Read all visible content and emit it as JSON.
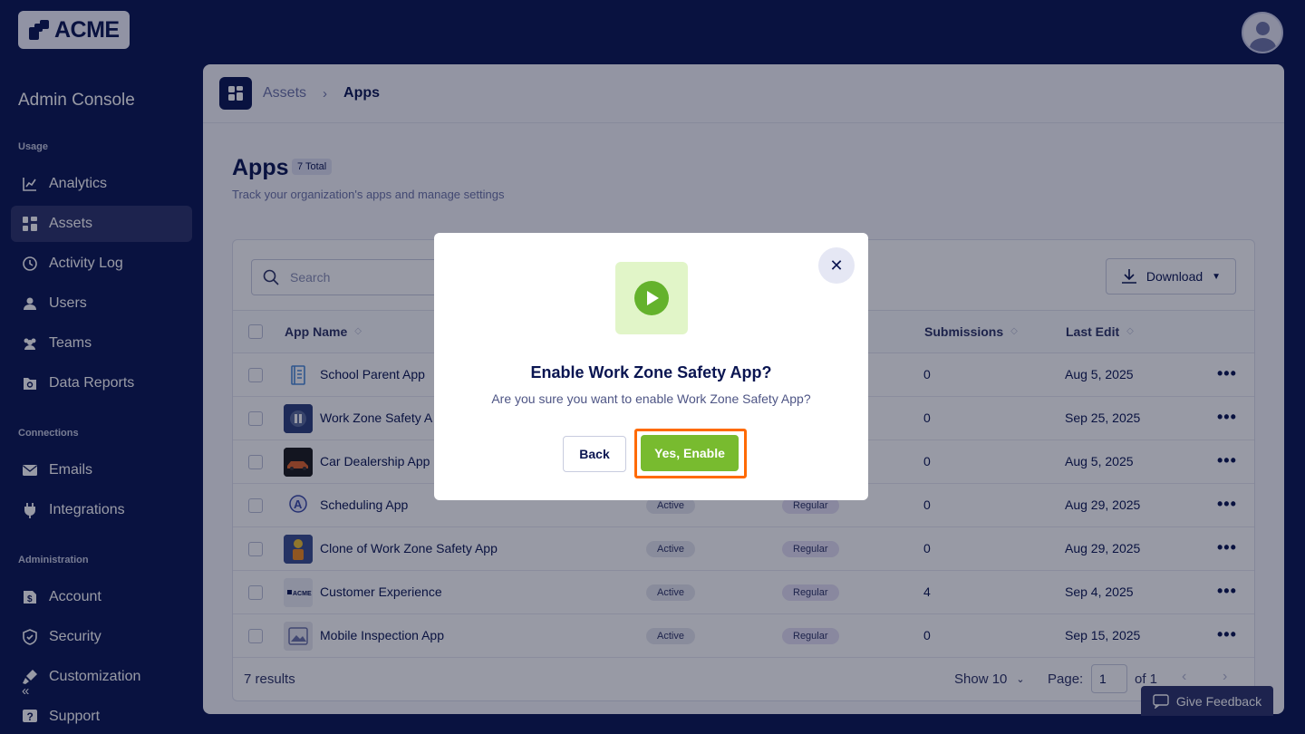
{
  "brand": {
    "logo_text": "ACME"
  },
  "sidebar": {
    "title": "Admin Console",
    "sections": [
      {
        "label": "Usage",
        "items": [
          {
            "label": "Analytics",
            "icon": "chart-line-icon",
            "active": false
          },
          {
            "label": "Assets",
            "icon": "grid-icon",
            "active": true
          },
          {
            "label": "Activity Log",
            "icon": "history-icon",
            "active": false
          },
          {
            "label": "Users",
            "icon": "user-icon",
            "active": false
          },
          {
            "label": "Teams",
            "icon": "team-icon",
            "active": false
          },
          {
            "label": "Data Reports",
            "icon": "report-icon",
            "active": false
          }
        ]
      },
      {
        "label": "Connections",
        "items": [
          {
            "label": "Emails",
            "icon": "mail-icon",
            "active": false
          },
          {
            "label": "Integrations",
            "icon": "plug-icon",
            "active": false
          }
        ]
      },
      {
        "label": "Administration",
        "items": [
          {
            "label": "Account",
            "icon": "account-icon",
            "active": false
          },
          {
            "label": "Security",
            "icon": "shield-icon",
            "active": false
          },
          {
            "label": "Customization",
            "icon": "brush-icon",
            "active": false
          },
          {
            "label": "Support",
            "icon": "help-icon",
            "active": false
          }
        ]
      }
    ]
  },
  "breadcrumb": {
    "parent": "Assets",
    "current": "Apps"
  },
  "page": {
    "title": "Apps",
    "total_badge": "7 Total",
    "subtitle": "Track your organization's apps and manage settings"
  },
  "toolbar": {
    "search_placeholder": "Search",
    "download_label": "Download"
  },
  "table": {
    "columns": {
      "app_name": "App Name",
      "submissions": "Submissions",
      "last_edit": "Last Edit"
    },
    "rows": [
      {
        "name": "School Parent App",
        "status": "",
        "type": "",
        "submissions": "0",
        "last_edit": "Aug 5, 2025"
      },
      {
        "name": "Work Zone Safety A",
        "status": "",
        "type": "",
        "submissions": "0",
        "last_edit": "Sep 25, 2025"
      },
      {
        "name": "Car Dealership App",
        "status": "",
        "type": "",
        "submissions": "0",
        "last_edit": "Aug 5, 2025"
      },
      {
        "name": "Scheduling App",
        "status": "Active",
        "type": "Regular",
        "submissions": "0",
        "last_edit": "Aug 29, 2025"
      },
      {
        "name": "Clone of Work Zone Safety App",
        "status": "Active",
        "type": "Regular",
        "submissions": "0",
        "last_edit": "Aug 29, 2025"
      },
      {
        "name": "Customer Experience",
        "status": "Active",
        "type": "Regular",
        "submissions": "4",
        "last_edit": "Sep 4, 2025"
      },
      {
        "name": "Mobile Inspection App",
        "status": "Active",
        "type": "Regular",
        "submissions": "0",
        "last_edit": "Sep 15, 2025"
      }
    ],
    "more_label": "•••"
  },
  "footer": {
    "results": "7 results",
    "show": "Show 10",
    "page_label": "Page:",
    "page_value": "1",
    "of_label": "of 1"
  },
  "feedback": {
    "label": "Give Feedback"
  },
  "modal": {
    "title": "Enable Work Zone Safety App?",
    "text": "Are you sure you want to enable Work Zone Safety App?",
    "back_label": "Back",
    "confirm_label": "Yes, Enable",
    "icon": "play-icon"
  },
  "colors": {
    "navy": "#0a1551",
    "confirm_green": "#78bb2f",
    "highlight_orange": "#ff6a00",
    "icon_bg_green": "#e1f5c8"
  }
}
